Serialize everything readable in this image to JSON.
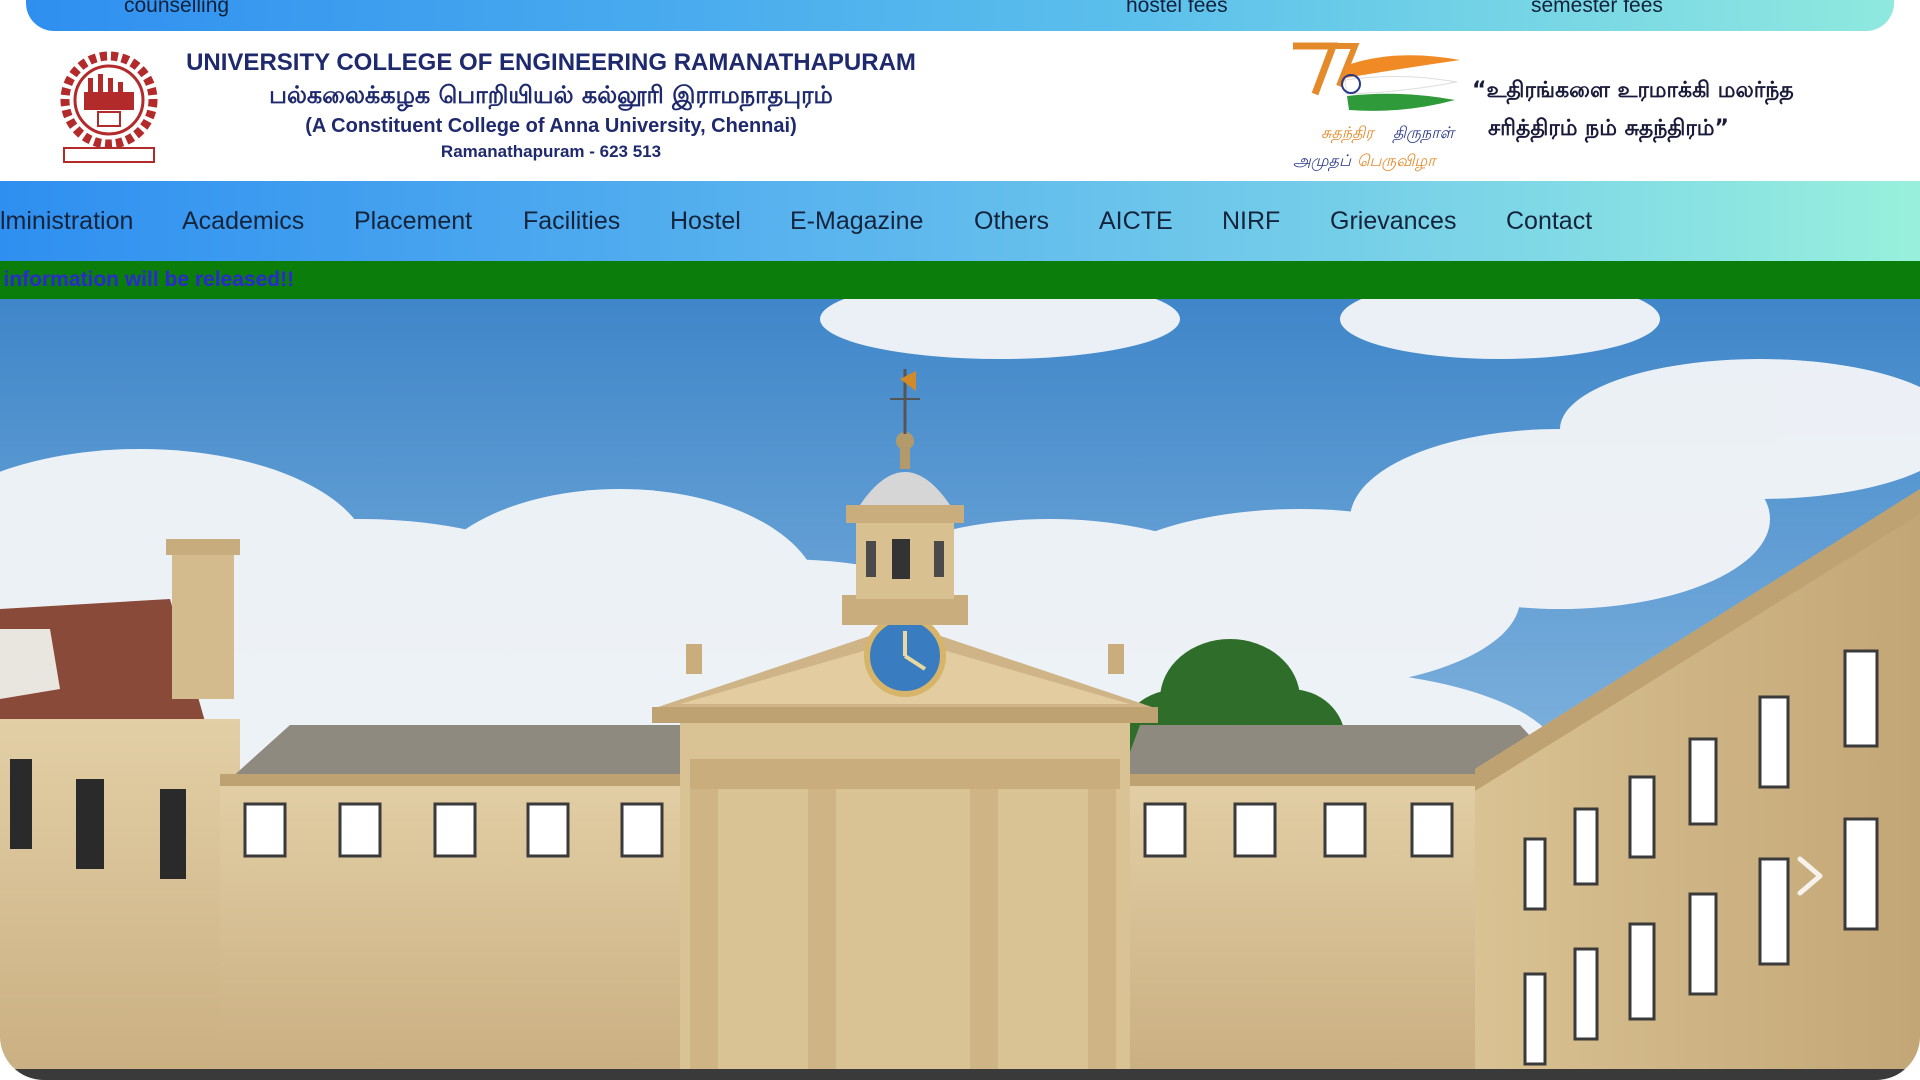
{
  "top_links": {
    "counselling": "counselling",
    "hostel_fees": "hostel fees",
    "semester_fees": "semester fees"
  },
  "header": {
    "title_en": "UNIVERSITY COLLEGE OF ENGINEERING RAMANATHAPURAM",
    "title_ta": "பல்கலைக்கழக பொறியியல் கல்லூரி இராமநாதபுரம்",
    "subtitle": "(A Constituent College of Anna University, Chennai)",
    "place": "Ramanathapuram - 623 513",
    "slogan_line1": "“உதிரங்களை உரமாக்கி மலர்ந்த",
    "slogan_line2": "சரித்திரம் நம் சுதந்திரம்”"
  },
  "nav": {
    "items": [
      {
        "label": "lministration"
      },
      {
        "label": "Academics"
      },
      {
        "label": "Placement"
      },
      {
        "label": "Facilities"
      },
      {
        "label": "Hostel"
      },
      {
        "label": "E-Magazine"
      },
      {
        "label": "Others"
      },
      {
        "label": "AICTE"
      },
      {
        "label": "NIRF"
      },
      {
        "label": "Grievances"
      },
      {
        "label": "Contact"
      }
    ]
  },
  "ticker": {
    "text": "e information will be released!!"
  },
  "colors": {
    "nav_gradient_start": "#2f8ff0",
    "nav_gradient_end": "#98f0dc",
    "ticker_bg": "#0a7d0a",
    "ticker_text": "#2a2ad0",
    "title_text": "#1f2a6e"
  },
  "icons": {
    "logo": "college-emblem-icon",
    "azadi": "azadi-ka-amrit-mahotsav-logo",
    "next": "chevron-right-icon"
  }
}
